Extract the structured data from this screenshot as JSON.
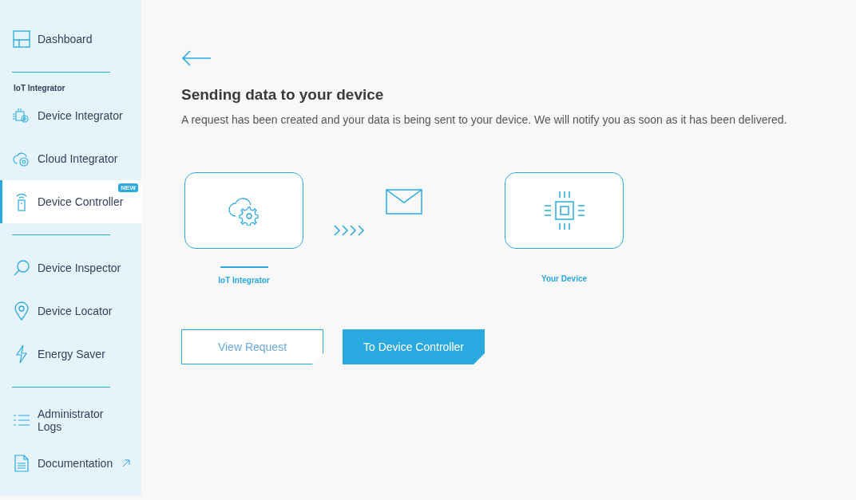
{
  "sidebar": {
    "items": [
      {
        "kind": "link",
        "label": "Dashboard",
        "selected": false
      },
      {
        "kind": "divider"
      },
      {
        "kind": "heading",
        "label": "IoT Integrator"
      },
      {
        "kind": "link",
        "label": "Device Integrator",
        "selected": false
      },
      {
        "kind": "link",
        "label": "Cloud Integrator",
        "selected": false
      },
      {
        "kind": "link",
        "label": "Device Controller",
        "selected": true,
        "badge": "NEW"
      },
      {
        "kind": "divider"
      },
      {
        "kind": "link",
        "label": "Device Inspector",
        "selected": false
      },
      {
        "kind": "link",
        "label": "Device Locator",
        "selected": false
      },
      {
        "kind": "link",
        "label": "Energy Saver",
        "selected": false
      },
      {
        "kind": "divider"
      },
      {
        "kind": "link",
        "label": "Administrator Logs",
        "selected": false
      },
      {
        "kind": "link",
        "label": "Documentation",
        "selected": false,
        "external": true
      }
    ]
  },
  "main": {
    "title": "Sending data to your device",
    "description": "A request has been created and your data is being sent to your device. We will notify you as soon as it has been delivered.",
    "diagram": {
      "source_label": "IoT Integrator",
      "target_label": "Your Device"
    },
    "buttons": [
      {
        "label": "View Request",
        "kind": "secondary"
      },
      {
        "label": "To Device Controller",
        "kind": "primary"
      }
    ]
  }
}
